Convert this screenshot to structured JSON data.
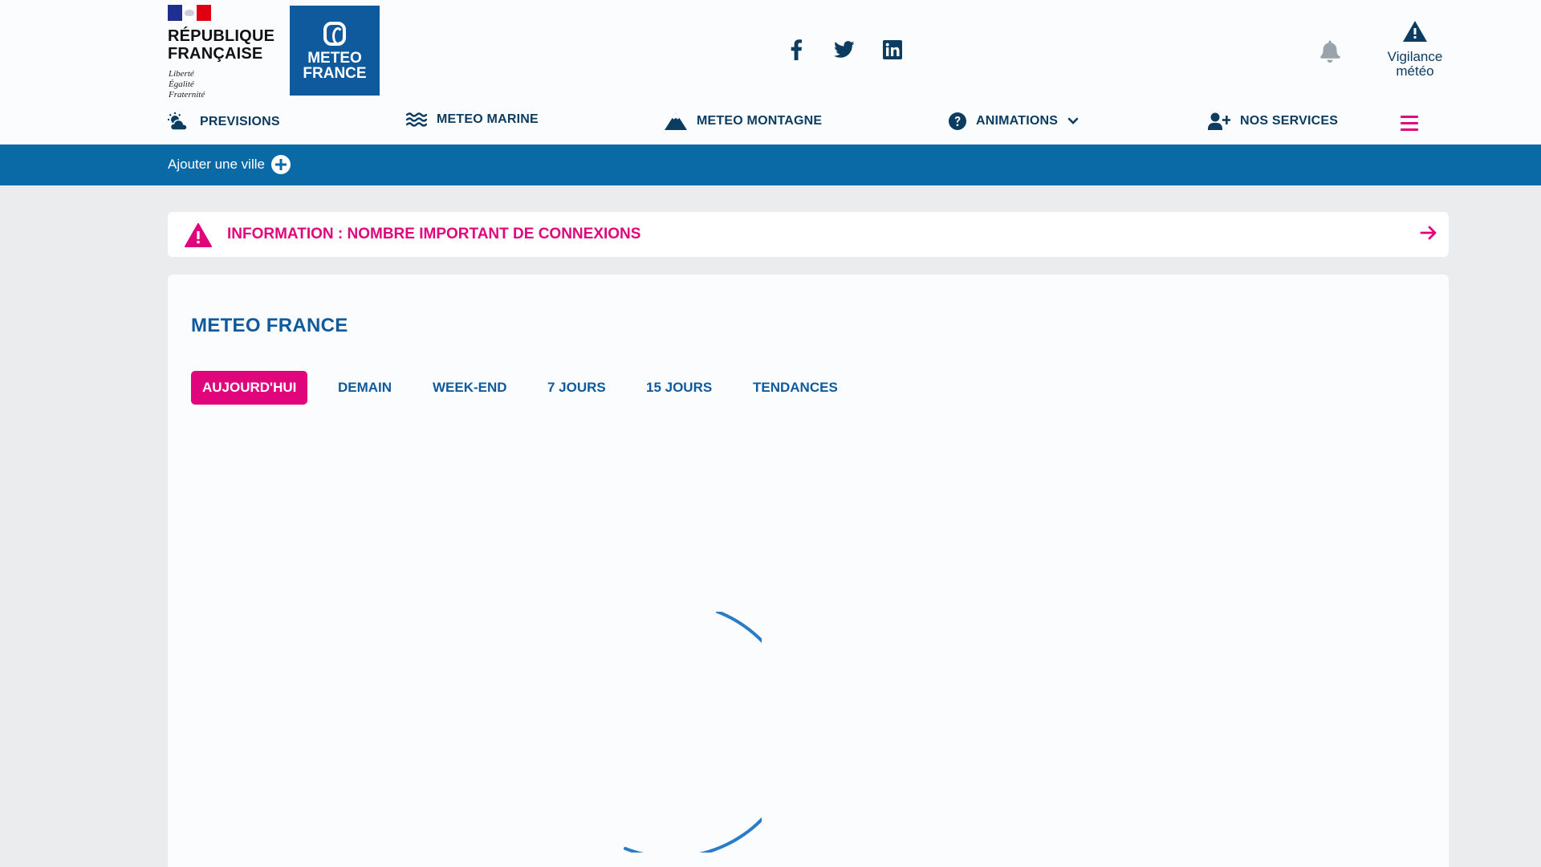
{
  "header": {
    "republique_name": "RÉPUBLIQUE FRANÇAISE",
    "republique_name_line1": "RÉPUBLIQUE",
    "republique_name_line2": "FRANÇAISE",
    "motto_line1": "Liberté",
    "motto_line2": "Égalité",
    "motto_line3": "Fraternité",
    "logo_text_line1": "METEO",
    "logo_text_line2": "FRANCE",
    "socials": [
      "facebook-icon",
      "twitter-icon",
      "linkedin-icon"
    ],
    "vigilance_line1": "Vigilance",
    "vigilance_line2": "météo"
  },
  "nav": {
    "items": [
      {
        "label": "PREVISIONS",
        "icon": "sun-cloud-icon"
      },
      {
        "label": "METEO MARINE",
        "icon": "waves-icon"
      },
      {
        "label": "METEO MONTAGNE",
        "icon": "mountain-icon"
      },
      {
        "label": "ANIMATIONS",
        "icon": "question-circle-icon"
      },
      {
        "label": "NOS SERVICES",
        "icon": "user-plus-icon"
      }
    ]
  },
  "citybar": {
    "add_city_label": "Ajouter une ville"
  },
  "banner": {
    "text": "INFORMATION : NOMBRE IMPORTANT DE CONNEXIONS"
  },
  "main": {
    "title": "METEO FRANCE",
    "tabs": [
      {
        "label": "AUJOURD'HUI",
        "active": true
      },
      {
        "label": "DEMAIN",
        "active": false
      },
      {
        "label": "WEEK-END",
        "active": false
      },
      {
        "label": "7 JOURS",
        "active": false
      },
      {
        "label": "15 JOURS",
        "active": false
      },
      {
        "label": "TENDANCES",
        "active": false
      }
    ]
  },
  "colors": {
    "brand_blue": "#0f5a9c",
    "citybar_blue": "#0a6aa5",
    "accent_pink": "#e1057c",
    "navy": "#0c3c60"
  }
}
